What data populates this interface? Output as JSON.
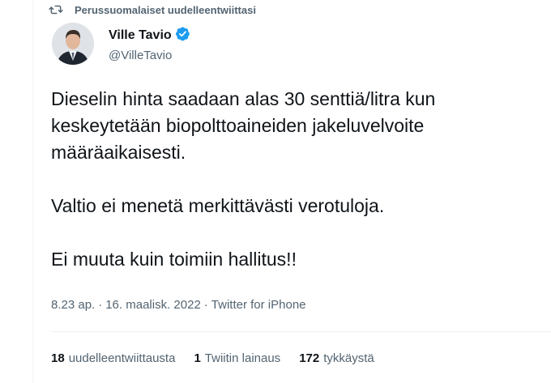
{
  "social_context": {
    "text": "Perussuomalaiset uudelleentwiittasi",
    "icon": "retweet-icon"
  },
  "author": {
    "display_name": "Ville Tavio",
    "handle": "@VilleTavio",
    "verified_icon": "verified-badge-icon",
    "verified_color": "#1d9bf0"
  },
  "tweet": {
    "paragraphs": [
      "Dieselin hinta saadaan alas 30 senttiä/litra kun keskeytetään biopolttoaineiden jakeluvelvoite määräaikaisesti.",
      "Valtio ei menetä merkittävästi verotuloja.",
      "Ei muuta kuin toimiin hallitus!!"
    ]
  },
  "meta": {
    "time": "8.23 ap.",
    "separator": "·",
    "date": "16. maalisk. 2022",
    "source": "Twitter for iPhone"
  },
  "stats": {
    "retweets": {
      "count": "18",
      "label": "uudelleentwiittausta"
    },
    "quotes": {
      "count": "1",
      "label": "Twiitin lainaus"
    },
    "likes": {
      "count": "172",
      "label": "tykkäystä"
    }
  },
  "colors": {
    "text_primary": "#0f1419",
    "text_secondary": "#536471",
    "divider": "#eff3f4"
  }
}
